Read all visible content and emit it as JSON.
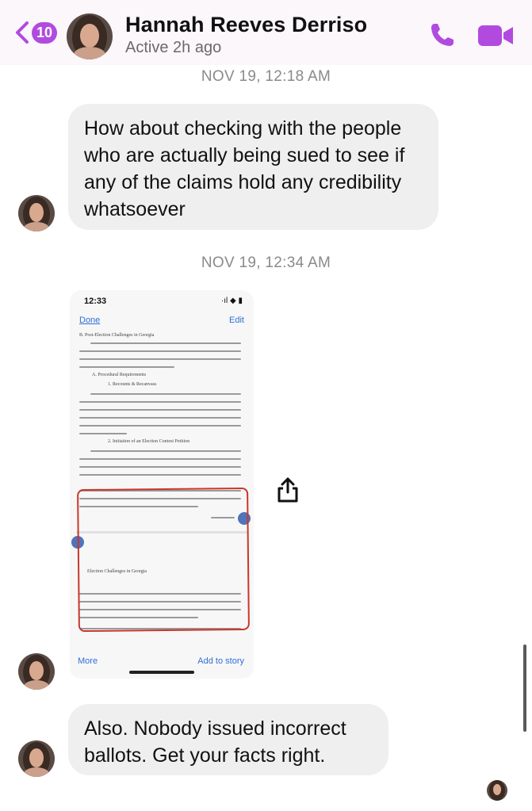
{
  "header": {
    "back_count": "10",
    "contact_name": "Hannah Reeves Derriso",
    "status": "Active 2h ago",
    "accent_color": "#b14be0",
    "icons": [
      "chevron-left-icon",
      "phone-icon",
      "video-camera-icon"
    ]
  },
  "messages": [
    {
      "type": "timestamp",
      "text": "NOV 19, 12:18 AM"
    },
    {
      "type": "text",
      "text": "How about checking with the people who are actually being sued to see if any of the claims hold any credibility whatsoever"
    },
    {
      "type": "timestamp",
      "text": "NOV 19, 12:34 AM"
    },
    {
      "type": "image"
    },
    {
      "type": "text",
      "text": "Also. Nobody issued incorrect ballots. Get your facts right."
    }
  ],
  "attachment": {
    "status_time": "12:33",
    "status_icons": "·ıl ◆ ▮",
    "done_label": "Done",
    "edit_label": "Edit",
    "heading_main": "B.    Post-Election Challenges in Georgia",
    "heading_a": "A.        Procedural Requirements",
    "heading_1": "1.        Recounts & Recanvass",
    "heading_2": "2.        Initiation of an Election Contest Petition",
    "heading_page2": "Election Challenges in Georgia",
    "more_label": "More",
    "story_label": "Add to story",
    "annotation_color": "#c8372b"
  }
}
